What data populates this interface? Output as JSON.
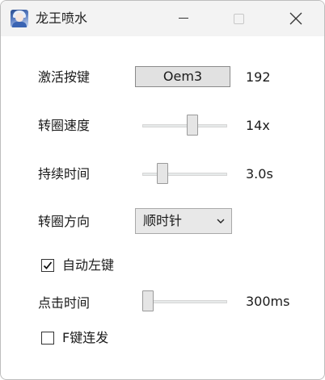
{
  "window": {
    "title": "龙王喷水"
  },
  "icons": {
    "app": "app-avatar-icon",
    "minimize": "minimize-icon",
    "maximize": "maximize-icon",
    "close": "close-icon",
    "dropdown": "chevron-down-icon",
    "check": "checkmark-icon"
  },
  "activation_key": {
    "label": "激活按键",
    "button_text": "Oem3",
    "code": "192"
  },
  "spin_speed": {
    "label": "转圈速度",
    "value_text": "14x",
    "level": 0.6
  },
  "duration": {
    "label": "持续时间",
    "value_text": "3.0s",
    "level": 0.2
  },
  "spin_direction": {
    "label": "转圈方向",
    "selected": "顺时针"
  },
  "auto_left_click": {
    "label": "自动左键",
    "checked": true
  },
  "click_time": {
    "label": "点击时间",
    "value_text": "300ms",
    "level": 0.0
  },
  "f_key_burst": {
    "label": "F键连发",
    "checked": false
  }
}
